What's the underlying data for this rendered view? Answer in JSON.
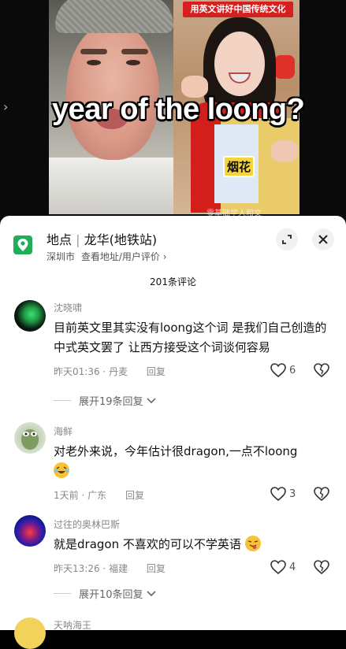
{
  "video": {
    "banner_text": "用英文讲好中国传统文化",
    "caption": "year of the loong?",
    "subtitle_word": "烟花",
    "watermark": "零基础学人和文"
  },
  "location_bar": {
    "label": "地点",
    "separator": "|",
    "place": "龙华(地铁站)",
    "city": "深圳市",
    "links": "查看地址/用户评价",
    "chevron": "›"
  },
  "comments_header": {
    "count_label": "201条评论"
  },
  "comments": [
    {
      "user": "沈晓啸",
      "text": "目前英文里其实没有loong这个词 是我们自己创造的中式英文罢了 让西方接受这个词谈何容易",
      "time": "昨天01:36",
      "dot": "·",
      "region": "丹麦",
      "reply_label": "回复",
      "likes": "6",
      "expand_label": "展开19条回复"
    },
    {
      "user": "海鲜",
      "text": "对老外来说，今年估计很dragon,一点不loong",
      "time": "1天前",
      "dot": "·",
      "region": "广东",
      "reply_label": "回复",
      "likes": "3"
    },
    {
      "user": "过往的奥林巴斯",
      "text": "就是dragon 不喜欢的可以不学英语",
      "time": "昨天13:26",
      "dot": "·",
      "region": "福建",
      "reply_label": "回复",
      "likes": "4",
      "expand_label": "展开10条回复"
    },
    {
      "user": "天呐海王"
    }
  ],
  "colors": {
    "location_icon": "#1fae55",
    "sheet_bg": "#ffffff",
    "meta_text": "#888888"
  }
}
